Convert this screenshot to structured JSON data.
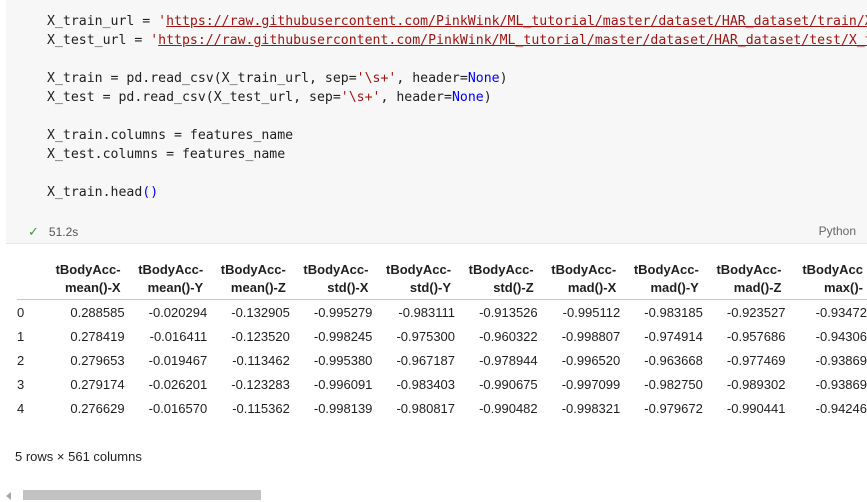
{
  "cell": {
    "code_lines": [
      [
        {
          "t": "X_train_url = "
        },
        {
          "t": "'",
          "c": "str"
        },
        {
          "t": "https://raw.githubusercontent.com/PinkWink/ML_tutorial/master/dataset/HAR_dataset/train/X_tr",
          "c": "str url"
        }
      ],
      [
        {
          "t": "X_test_url = "
        },
        {
          "t": "'",
          "c": "str"
        },
        {
          "t": "https://raw.githubusercontent.com/PinkWink/ML_tutorial/master/dataset/HAR_dataset/test/X_test",
          "c": "str url"
        }
      ],
      [],
      [
        {
          "t": "X_train = pd.read_csv(X_train_url, sep="
        },
        {
          "t": "'\\s+'",
          "c": "str"
        },
        {
          "t": ", header="
        },
        {
          "t": "None",
          "c": "kw"
        },
        {
          "t": ")"
        }
      ],
      [
        {
          "t": "X_test = pd.read_csv(X_test_url, sep="
        },
        {
          "t": "'\\s+'",
          "c": "str"
        },
        {
          "t": ", header="
        },
        {
          "t": "None",
          "c": "kw"
        },
        {
          "t": ")"
        }
      ],
      [],
      [
        {
          "t": "X_train.columns = features_name"
        }
      ],
      [
        {
          "t": "X_test.columns = features_name"
        }
      ],
      [],
      [
        {
          "t": "X_train.head"
        },
        {
          "t": "()",
          "c": "kw"
        }
      ]
    ],
    "status": {
      "check_icon": "✓",
      "time": "51.2s"
    },
    "language": "Python"
  },
  "output": {
    "columns": [
      {
        "top": "tBodyAcc-",
        "bottom": "mean()-X"
      },
      {
        "top": "tBodyAcc-",
        "bottom": "mean()-Y"
      },
      {
        "top": "tBodyAcc-",
        "bottom": "mean()-Z"
      },
      {
        "top": "tBodyAcc-",
        "bottom": "std()-X"
      },
      {
        "top": "tBodyAcc-",
        "bottom": "std()-Y"
      },
      {
        "top": "tBodyAcc-",
        "bottom": "std()-Z"
      },
      {
        "top": "tBodyAcc-",
        "bottom": "mad()-X"
      },
      {
        "top": "tBodyAcc-",
        "bottom": "mad()-Y"
      },
      {
        "top": "tBodyAcc-",
        "bottom": "mad()-Z"
      },
      {
        "top": "tBodyAcc",
        "bottom": "max()-"
      }
    ],
    "rows": [
      {
        "index": "0",
        "values": [
          "0.288585",
          "-0.020294",
          "-0.132905",
          "-0.995279",
          "-0.983111",
          "-0.913526",
          "-0.995112",
          "-0.983185",
          "-0.923527",
          "-0.93472"
        ]
      },
      {
        "index": "1",
        "values": [
          "0.278419",
          "-0.016411",
          "-0.123520",
          "-0.998245",
          "-0.975300",
          "-0.960322",
          "-0.998807",
          "-0.974914",
          "-0.957686",
          "-0.94306"
        ]
      },
      {
        "index": "2",
        "values": [
          "0.279653",
          "-0.019467",
          "-0.113462",
          "-0.995380",
          "-0.967187",
          "-0.978944",
          "-0.996520",
          "-0.963668",
          "-0.977469",
          "-0.93869"
        ]
      },
      {
        "index": "3",
        "values": [
          "0.279174",
          "-0.026201",
          "-0.123283",
          "-0.996091",
          "-0.983403",
          "-0.990675",
          "-0.997099",
          "-0.982750",
          "-0.989302",
          "-0.93869"
        ]
      },
      {
        "index": "4",
        "values": [
          "0.276629",
          "-0.016570",
          "-0.115362",
          "-0.998139",
          "-0.980817",
          "-0.990482",
          "-0.998321",
          "-0.979672",
          "-0.990441",
          "-0.94246"
        ]
      }
    ],
    "summary": "5 rows × 561 columns"
  }
}
